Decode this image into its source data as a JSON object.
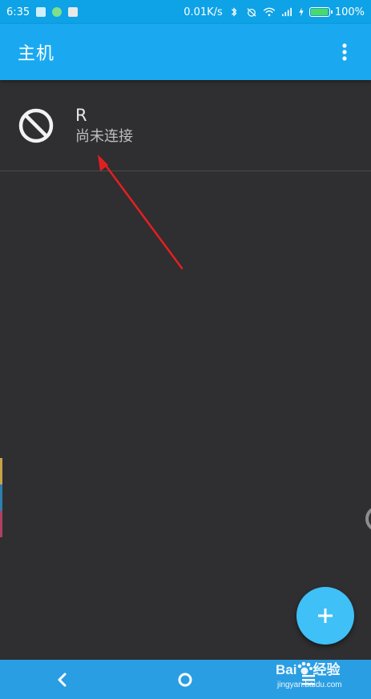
{
  "status_bar": {
    "time": "6:35",
    "network_speed": "0.01K/s",
    "battery_percent": "100%",
    "battery_level": 1.0
  },
  "app_bar": {
    "title": "主机",
    "overflow_icon": "more-vert-icon"
  },
  "hosts": [
    {
      "name": "R",
      "status": "尚未连接",
      "icon": "not-connected-icon"
    }
  ],
  "fab": {
    "icon": "plus-icon"
  },
  "nav_bar": {
    "back_icon": "back-chevron-icon",
    "home_icon": "home-circle-icon",
    "menu_icon": "menu-lines-icon"
  },
  "watermark": {
    "brand": "Bai",
    "brand_suffix": "经验",
    "url": "jingyan.baidu.com"
  },
  "colors": {
    "status_bar": "#0ea2e6",
    "app_bar": "#1aa9f0",
    "background": "#2f2e31",
    "fab": "#3fc0f6",
    "nav_bar": "#2a9ee3",
    "annotation": "#e02020"
  }
}
